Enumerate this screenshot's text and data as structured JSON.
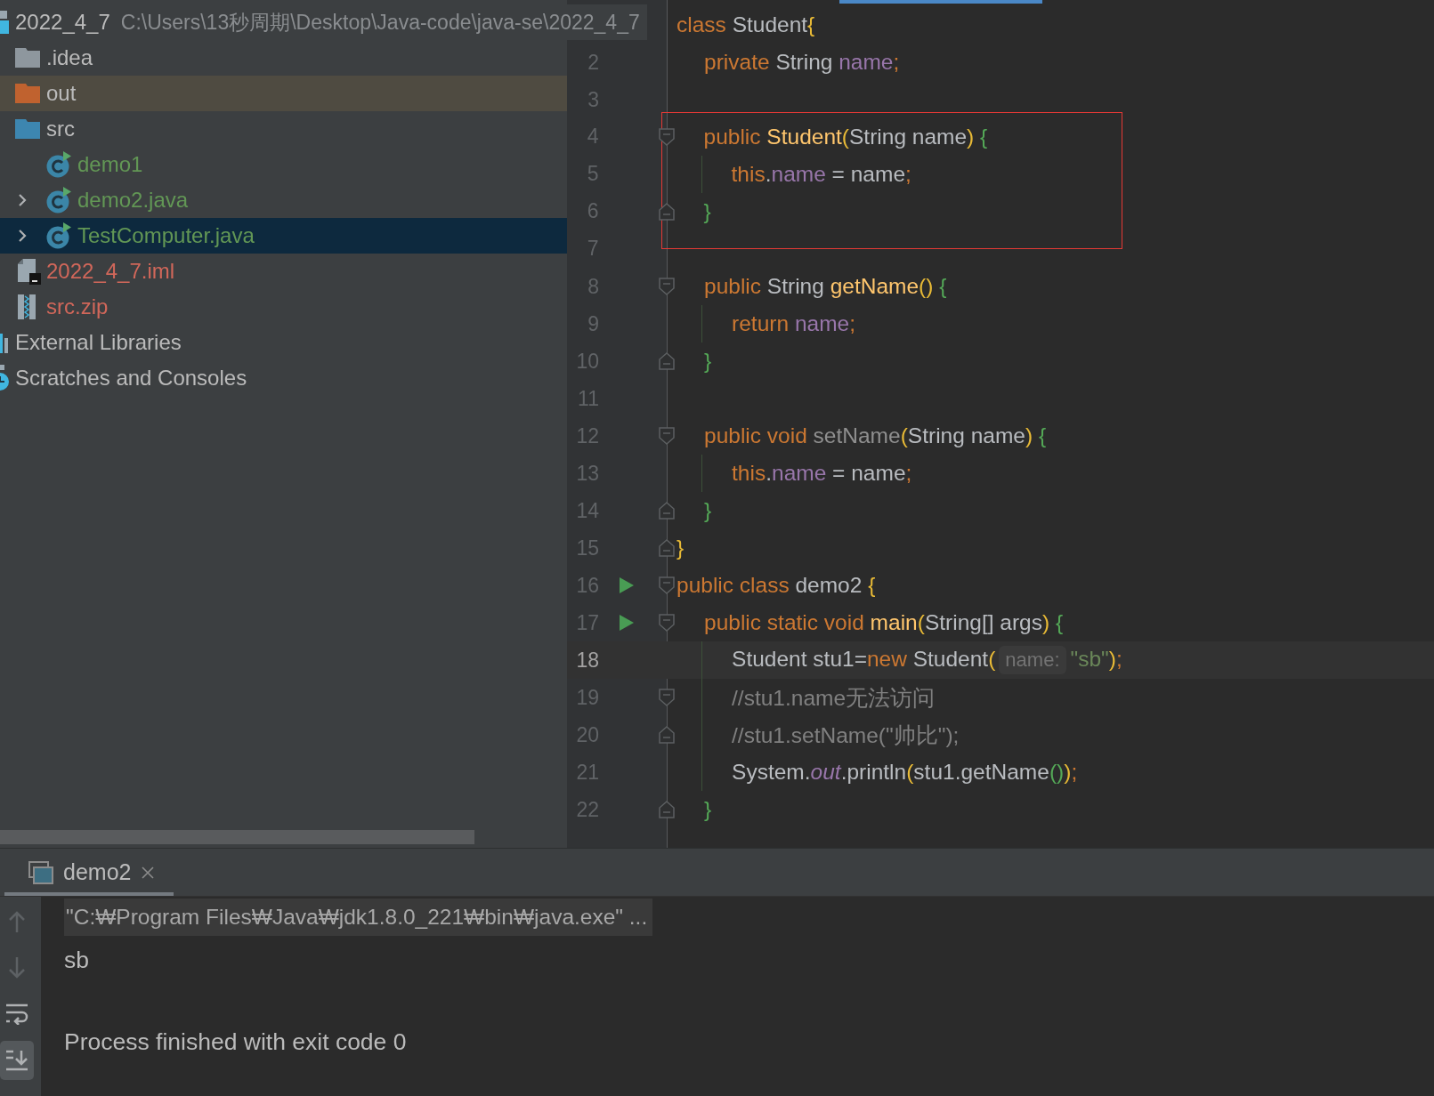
{
  "project_tree": {
    "items": [
      {
        "name": "2022_4_7",
        "path": "C:\\Users\\13秒周期\\Desktop\\Java-code\\java-se\\2022_4_7",
        "kind": "module",
        "vcs_added": false,
        "vcs_unversioned": false,
        "selected": false,
        "highlighted": false,
        "children": [
          {
            "name": ".idea",
            "kind": "folder",
            "vcs_added": false,
            "vcs_unversioned": false,
            "selected": false,
            "highlighted": false
          },
          {
            "name": "out",
            "kind": "excluded_folder",
            "vcs_added": false,
            "vcs_unversioned": false,
            "selected": false,
            "highlighted": true
          },
          {
            "name": "src",
            "kind": "source_folder",
            "vcs_added": false,
            "vcs_unversioned": false,
            "selected": false,
            "highlighted": false,
            "children": [
              {
                "name": "demo1",
                "kind": "runnable_class",
                "vcs_added": true,
                "vcs_unversioned": false,
                "selected": false,
                "highlighted": false
              },
              {
                "name": "demo2.java",
                "kind": "runnable_class",
                "vcs_added": true,
                "vcs_unversioned": false,
                "selected": false,
                "highlighted": false,
                "expanded": false
              },
              {
                "name": "TestComputer.java",
                "kind": "runnable_class",
                "vcs_added": true,
                "vcs_unversioned": false,
                "selected": true,
                "highlighted": false,
                "expanded": false
              }
            ]
          },
          {
            "name": "2022_4_7.iml",
            "kind": "module_file",
            "vcs_added": false,
            "vcs_unversioned": true,
            "selected": false,
            "highlighted": false
          },
          {
            "name": "src.zip",
            "kind": "archive",
            "vcs_added": false,
            "vcs_unversioned": true,
            "selected": false,
            "highlighted": false
          }
        ]
      },
      {
        "name": "External Libraries",
        "kind": "libraries",
        "vcs_added": false,
        "vcs_unversioned": false,
        "selected": false,
        "highlighted": false
      },
      {
        "name": "Scratches and Consoles",
        "kind": "scratches",
        "vcs_added": false,
        "vcs_unversioned": false,
        "selected": false,
        "highlighted": false
      }
    ]
  },
  "editor": {
    "sections": [
      {
        "lines": [
          {
            "current": false,
            "tokens": [
              {
                "kind": "keyword",
                "text": "class "
              },
              {
                "kind": "plain",
                "text": "Student"
              },
              {
                "kind": "bracket",
                "text": "{"
              }
            ]
          },
          {
            "number": "2",
            "current": false,
            "tokens": [
              {
                "kind": "keyword",
                "text": "    private "
              },
              {
                "kind": "plain",
                "text": "String "
              },
              {
                "kind": "field",
                "text": "name"
              },
              {
                "kind": "keyword",
                "text": ";"
              }
            ]
          },
          {
            "number": "3",
            "current": false
          }
        ]
      },
      {
        "annotation": {
          "kind": "red_box"
        },
        "lines": [
          {
            "number": "4",
            "current": false,
            "markers": [
              {
                "kind": "fold_start"
              }
            ],
            "tokens": [
              {
                "kind": "keyword",
                "text": "    public "
              },
              {
                "kind": "method",
                "text": "Student"
              },
              {
                "kind": "bracket",
                "text": "("
              },
              {
                "kind": "plain",
                "text": "String name"
              },
              {
                "kind": "bracket",
                "text": ")"
              },
              {
                "kind": "nested_bracket",
                "text": " {"
              }
            ]
          },
          {
            "number": "5",
            "current": false,
            "markers": [
              {
                "kind": "indent_guide"
              }
            ],
            "tokens": [
              {
                "kind": "keyword",
                "text": "        this"
              },
              {
                "kind": "plain",
                "text": "."
              },
              {
                "kind": "field",
                "text": "name"
              },
              {
                "kind": "plain",
                "text": " = name"
              },
              {
                "kind": "keyword",
                "text": ";"
              }
            ]
          },
          {
            "number": "6",
            "current": false,
            "markers": [
              {
                "kind": "fold_end"
              }
            ],
            "tokens": [
              {
                "kind": "nested_bracket",
                "text": "    }"
              }
            ]
          },
          {
            "number": "7",
            "current": false
          }
        ]
      },
      {
        "lines": [
          {
            "number": "8",
            "current": false,
            "markers": [
              {
                "kind": "fold_start"
              }
            ],
            "tokens": [
              {
                "kind": "keyword",
                "text": "    public "
              },
              {
                "kind": "plain",
                "text": "String "
              },
              {
                "kind": "method",
                "text": "getName"
              },
              {
                "kind": "bracket",
                "text": "()"
              },
              {
                "kind": "nested_bracket",
                "text": " {"
              }
            ]
          },
          {
            "number": "9",
            "current": false,
            "markers": [
              {
                "kind": "indent_guide"
              }
            ],
            "tokens": [
              {
                "kind": "keyword",
                "text": "        return "
              },
              {
                "kind": "field",
                "text": "name"
              },
              {
                "kind": "keyword",
                "text": ";"
              }
            ]
          },
          {
            "number": "10",
            "current": false,
            "markers": [
              {
                "kind": "fold_end"
              }
            ],
            "tokens": [
              {
                "kind": "nested_bracket",
                "text": "    }"
              }
            ]
          },
          {
            "number": "11",
            "current": false
          },
          {
            "number": "12",
            "current": false,
            "markers": [
              {
                "kind": "fold_start"
              }
            ],
            "tokens": [
              {
                "kind": "keyword",
                "text": "    public void "
              },
              {
                "kind": "unused",
                "text": "setName"
              },
              {
                "kind": "bracket",
                "text": "("
              },
              {
                "kind": "plain",
                "text": "String name"
              },
              {
                "kind": "bracket",
                "text": ")"
              },
              {
                "kind": "nested_bracket",
                "text": " {"
              }
            ]
          },
          {
            "number": "13",
            "current": false,
            "markers": [
              {
                "kind": "indent_guide"
              }
            ],
            "tokens": [
              {
                "kind": "keyword",
                "text": "        this"
              },
              {
                "kind": "plain",
                "text": "."
              },
              {
                "kind": "field",
                "text": "name"
              },
              {
                "kind": "plain",
                "text": " = name"
              },
              {
                "kind": "keyword",
                "text": ";"
              }
            ]
          },
          {
            "number": "14",
            "current": false,
            "markers": [
              {
                "kind": "fold_end"
              }
            ],
            "tokens": [
              {
                "kind": "nested_bracket",
                "text": "    }"
              }
            ]
          },
          {
            "number": "15",
            "current": false,
            "markers": [
              {
                "kind": "fold_end"
              }
            ],
            "tokens": [
              {
                "kind": "bracket",
                "text": "}"
              }
            ]
          },
          {
            "number": "16",
            "current": false,
            "markers": [
              {
                "kind": "run"
              },
              {
                "kind": "fold_start"
              }
            ],
            "tokens": [
              {
                "kind": "keyword",
                "text": "public class "
              },
              {
                "kind": "plain",
                "text": "demo2 "
              },
              {
                "kind": "bracket",
                "text": "{"
              }
            ]
          },
          {
            "number": "17",
            "current": false,
            "markers": [
              {
                "kind": "run"
              },
              {
                "kind": "fold_start"
              }
            ],
            "tokens": [
              {
                "kind": "keyword",
                "text": "    public static void "
              },
              {
                "kind": "method",
                "text": "main"
              },
              {
                "kind": "bracket",
                "text": "("
              },
              {
                "kind": "plain",
                "text": "String[] args"
              },
              {
                "kind": "bracket",
                "text": ")"
              },
              {
                "kind": "nested_bracket",
                "text": " {"
              }
            ]
          },
          {
            "number": "18",
            "current": true,
            "markers": [
              {
                "kind": "indent_guide"
              }
            ],
            "tokens": [
              {
                "kind": "plain",
                "text": "        Student stu1="
              },
              {
                "kind": "keyword",
                "text": "new "
              },
              {
                "kind": "plain",
                "text": "Student"
              },
              {
                "kind": "bracket",
                "text": "("
              },
              {
                "kind": "hint",
                "text": "name:"
              },
              {
                "kind": "string",
                "text": "\"sb\""
              },
              {
                "kind": "bracket",
                "text": ")"
              },
              {
                "kind": "keyword",
                "text": ";"
              }
            ]
          },
          {
            "number": "19",
            "current": false,
            "markers": [
              {
                "kind": "fold_start"
              },
              {
                "kind": "indent_guide"
              }
            ],
            "tokens": [
              {
                "kind": "comment",
                "text": "        //stu1.name无法访问"
              }
            ]
          },
          {
            "number": "20",
            "current": false,
            "markers": [
              {
                "kind": "fold_end"
              },
              {
                "kind": "indent_guide"
              }
            ],
            "tokens": [
              {
                "kind": "comment",
                "text": "        //stu1.setName(\"帅比\");"
              }
            ]
          },
          {
            "number": "21",
            "current": false,
            "markers": [
              {
                "kind": "indent_guide"
              }
            ],
            "tokens": [
              {
                "kind": "plain",
                "text": "        System."
              },
              {
                "kind": "static_field",
                "text": "out"
              },
              {
                "kind": "plain",
                "text": ".println"
              },
              {
                "kind": "bracket",
                "text": "("
              },
              {
                "kind": "plain",
                "text": "stu1.getName"
              },
              {
                "kind": "nested_bracket",
                "text": "()"
              },
              {
                "kind": "bracket",
                "text": ")"
              },
              {
                "kind": "keyword",
                "text": ";"
              }
            ]
          },
          {
            "number": "22",
            "current": false,
            "markers": [
              {
                "kind": "fold_end"
              }
            ],
            "tokens": [
              {
                "kind": "nested_bracket",
                "text": "    }"
              }
            ]
          }
        ]
      }
    ]
  },
  "run_panel": {
    "tabs": [
      {
        "label": "demo2",
        "selected": true
      }
    ],
    "toolbar": [
      {
        "kind": "up",
        "disabled": true,
        "on": false
      },
      {
        "kind": "down",
        "disabled": true,
        "on": false
      },
      {
        "kind": "soft_wrap",
        "disabled": false,
        "on": false
      },
      {
        "kind": "scroll_to_end",
        "disabled": false,
        "on": true
      }
    ],
    "output": [
      {
        "kind": "command",
        "text": "\"C:₩Program Files₩Java₩jdk1.8.0_221₩bin₩java.exe\" ..."
      },
      {
        "kind": "stdout",
        "text": "sb"
      },
      {
        "kind": "exit",
        "text": "Process finished with exit code 0"
      }
    ]
  }
}
